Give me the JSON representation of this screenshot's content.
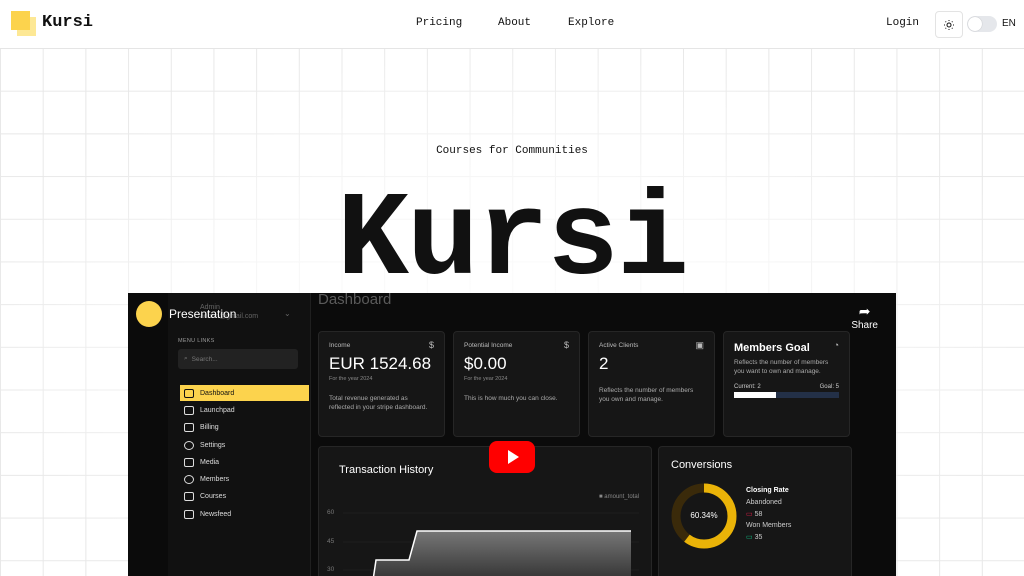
{
  "header": {
    "brand": "Kursi",
    "nav": [
      "Pricing",
      "About",
      "Explore"
    ],
    "login": "Login",
    "language": "EN",
    "theme_icon": "sun-icon"
  },
  "hero": {
    "tagline": "Courses for Communities",
    "title": "Kursi"
  },
  "video": {
    "title": "Presentation",
    "share_label": "Share",
    "dashboard": {
      "title": "Dashboard",
      "user": {
        "name": "Admin",
        "email": "admin@gmail.com"
      },
      "menu_heading": "MENU LINKS",
      "search_placeholder": "Search...",
      "menu": [
        "Dashboard",
        "Launchpad",
        "Billing",
        "Settings",
        "Media",
        "Members",
        "Courses",
        "Newsfeed"
      ],
      "cards": [
        {
          "label": "Income",
          "value": "EUR 1524.68",
          "sub": "For the year 2024",
          "desc": "Total revenue generated as reflected in your stripe dashboard."
        },
        {
          "label": "Potential Income",
          "value": "$0.00",
          "sub": "For the year 2024",
          "desc": "This is how much you can close."
        },
        {
          "label": "Active Clients",
          "value": "2",
          "sub": "",
          "desc": "Reflects the number of members you own and manage."
        },
        {
          "label": "Members Goal",
          "desc": "Reflects the number of members you want to own and manage.",
          "current": "Current: 2",
          "goal": "Goal: 5",
          "progress": 0.4
        }
      ],
      "transactions": {
        "title": "Transaction History",
        "legend": "amount_total",
        "y_ticks": [
          "60",
          "45",
          "30"
        ]
      },
      "conversions": {
        "title": "Conversions",
        "rate": "60.34%",
        "closing_label": "Closing Rate",
        "abandoned_label": "Abandoned",
        "abandoned": "58",
        "won_label": "Won Members",
        "won": "35",
        "ring_fraction": 0.6034
      }
    }
  },
  "colors": {
    "accent": "#fcd34d",
    "youtube": "#ff0000",
    "dark": "#0b0b0b"
  }
}
